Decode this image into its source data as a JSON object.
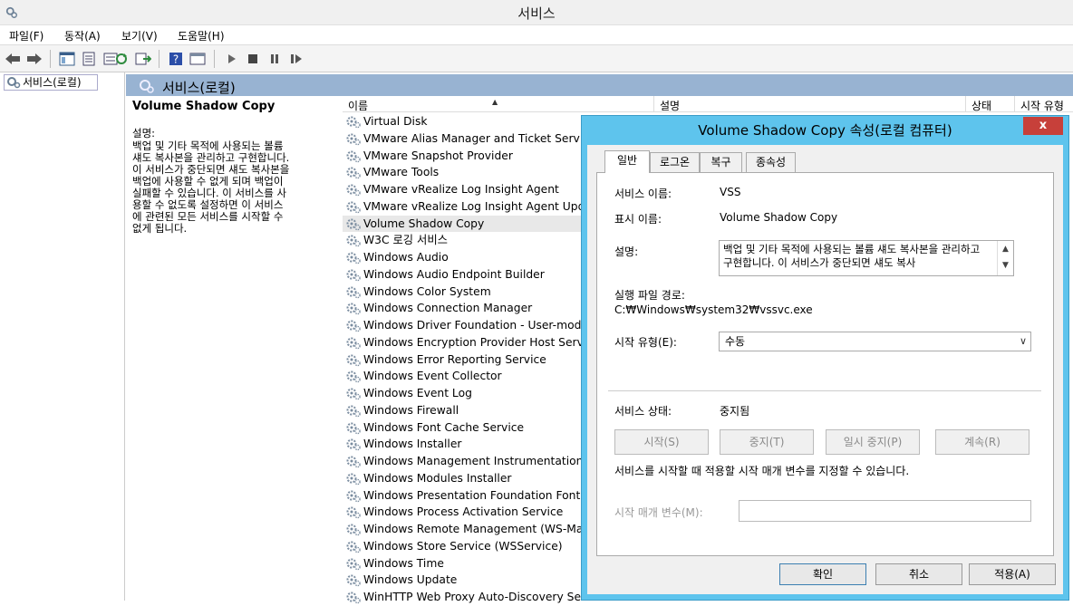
{
  "window": {
    "title": "서비스"
  },
  "menu": [
    "파일(F)",
    "동작(A)",
    "보기(V)",
    "도움말(H)"
  ],
  "toolbar": [
    "back-arrow-icon",
    "forward-arrow-icon",
    "console-tree-icon",
    "properties-icon",
    "refresh-icon",
    "export-list-icon",
    "help-icon",
    "view-icon",
    "start-icon",
    "stop-icon",
    "pause-icon",
    "restart-icon"
  ],
  "tree": {
    "root": "서비스(로컬)"
  },
  "header": {
    "title": "서비스(로컬)"
  },
  "description_pane": {
    "service_name": "Volume Shadow Copy",
    "label": "설명:",
    "text": "백업 및 기타 목적에 사용되는 볼륨\n섀도 복사본을 관리하고 구현합니다.\n이 서비스가 중단되면 섀도 복사본을\n백업에 사용할 수 없게 되며 백업이\n실패할 수 있습니다. 이 서비스를 사\n용할 수 없도록 설정하면 이 서비스\n에 관련된 모든 서비스를 시작할 수\n없게 됩니다."
  },
  "list": {
    "columns": [
      "이름",
      "설명",
      "상태",
      "시작 유형"
    ],
    "rows": [
      "Virtual Disk",
      "VMware Alias Manager and Ticket Servic",
      "VMware Snapshot Provider",
      "VMware Tools",
      "VMware vRealize Log Insight Agent",
      "VMware vRealize Log Insight Agent Upd",
      "Volume Shadow Copy",
      "W3C 로깅 서비스",
      "Windows Audio",
      "Windows Audio Endpoint Builder",
      "Windows Color System",
      "Windows Connection Manager",
      "Windows Driver Foundation - User-mod",
      "Windows Encryption Provider Host Servi",
      "Windows Error Reporting Service",
      "Windows Event Collector",
      "Windows Event Log",
      "Windows Firewall",
      "Windows Font Cache Service",
      "Windows Installer",
      "Windows Management Instrumentation",
      "Windows Modules Installer",
      "Windows Presentation Foundation Font",
      "Windows Process Activation Service",
      "Windows Remote Management (WS-Ma",
      "Windows Store Service (WSService)",
      "Windows Time",
      "Windows Update",
      "WinHTTP Web Proxy Auto-Discovery Se"
    ],
    "selected_index": 6
  },
  "dialog": {
    "title": "Volume Shadow Copy 속성(로컬 컴퓨터)",
    "close": "x",
    "tabs": [
      "일반",
      "로그온",
      "복구",
      "종속성"
    ],
    "service_name_label": "서비스 이름:",
    "service_name_value": "VSS",
    "display_name_label": "표시 이름:",
    "display_name_value": "Volume Shadow Copy",
    "description_label": "설명:",
    "description_value": "백업 및 기타 목적에 사용되는 볼륨 섀도 복사본을 관리하고 구현합니다. 이 서비스가 중단되면 섀도 복사",
    "path_label": "실행 파일 경로:",
    "path_value": "C:₩Windows₩system32₩vssvc.exe",
    "startup_type_label": "시작 유형(E):",
    "startup_type_value": "수동",
    "status_label": "서비스 상태:",
    "status_value": "중지됨",
    "buttons": [
      "시작(S)",
      "중지(T)",
      "일시 중지(P)",
      "계속(R)"
    ],
    "hint": "서비스를 시작할 때 적용할 시작 매개 변수를 지정할 수 있습니다.",
    "param_label": "시작 매개 변수(M):",
    "param_value": "",
    "footer": [
      "확인",
      "취소",
      "적용(A)"
    ],
    "highlight_color": "#e02020"
  }
}
